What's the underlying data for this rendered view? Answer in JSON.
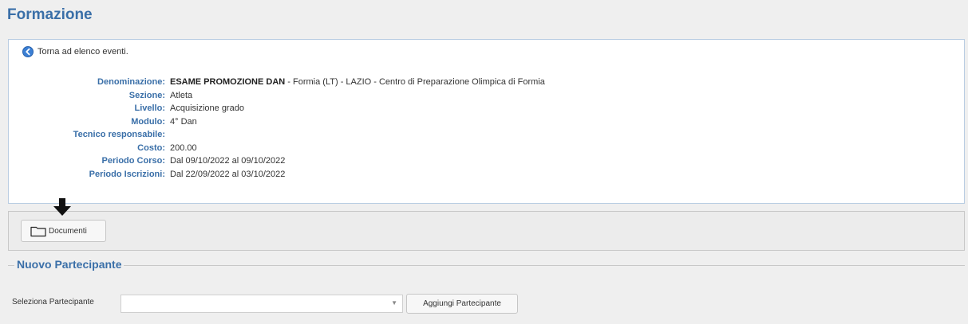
{
  "page": {
    "title": "Formazione"
  },
  "back_link": {
    "label": "Torna ad elenco eventi."
  },
  "details": {
    "denominazione_label": "Denominazione:",
    "denominazione_name": "ESAME PROMOZIONE DAN",
    "denominazione_rest": " - Formia (LT) - LAZIO - Centro di Preparazione Olimpica di Formia",
    "sezione_label": "Sezione:",
    "sezione_value": "Atleta",
    "livello_label": "Livello:",
    "livello_value": "Acquisizione grado",
    "modulo_label": "Modulo:",
    "modulo_value": "4° Dan",
    "tecnico_label": "Tecnico responsabile:",
    "tecnico_value": "",
    "costo_label": "Costo:",
    "costo_value": "200.00",
    "periodo_corso_label": "Periodo Corso:",
    "periodo_corso_value": "Dal 09/10/2022 al 09/10/2022",
    "periodo_iscrizioni_label": "Periodo Iscrizioni:",
    "periodo_iscrizioni_value": "Dal 22/09/2022 al 03/10/2022"
  },
  "documents": {
    "button_label": "Documenti"
  },
  "new_participant": {
    "legend": "Nuovo Partecipante",
    "select_label": "Seleziona Partecipante",
    "select_value": "",
    "add_button_label": "Aggiungi Partecipante"
  },
  "icons": {
    "back": "back-arrow-circle-icon",
    "folder": "folder-icon",
    "dropdown": "chevron-down-icon",
    "annotation": "down-arrow-icon"
  },
  "colors": {
    "accent": "#3a6fa8",
    "background": "#efefef",
    "panel_border": "#b9cde2"
  }
}
